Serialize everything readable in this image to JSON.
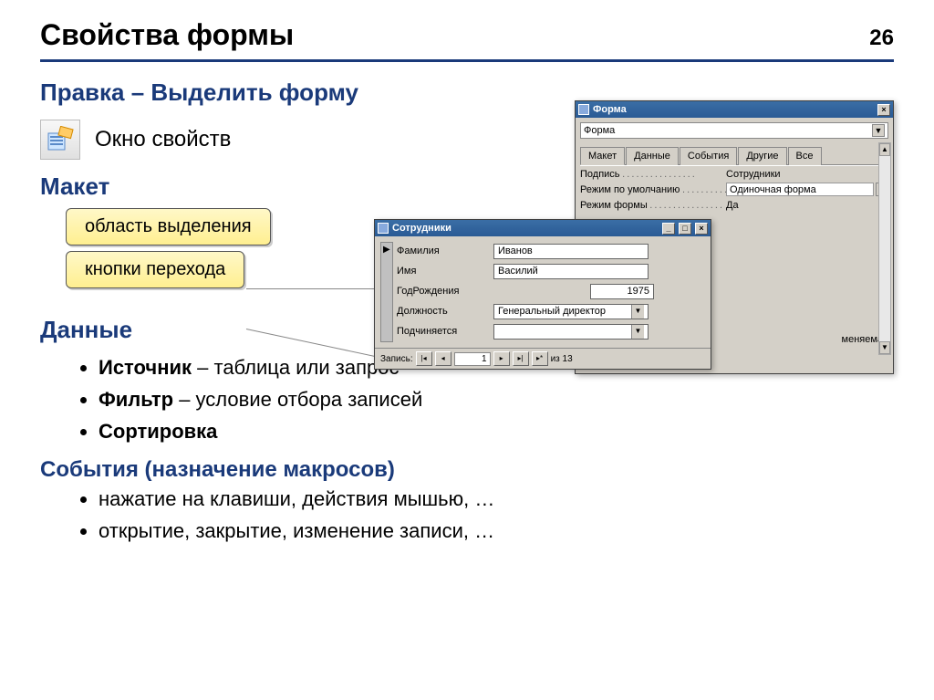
{
  "pageNumber": "26",
  "title": "Свойства формы",
  "breadcrumb": "Правка – Выделить форму",
  "propsIconLabel": "Окно свойств",
  "sections": {
    "maket": "Макет",
    "data": "Данные",
    "events": "События (назначение макросов)"
  },
  "callouts": {
    "selectionArea": "область выделения",
    "navButtons": "кнопки перехода"
  },
  "dataBullets": {
    "b1bold": "Источник",
    "b1rest": " – таблица или запрос",
    "b2bold": "Фильтр",
    "b2rest": " – условие отбора записей",
    "b3": "Сортировка"
  },
  "eventBullets": {
    "e1": "нажатие на клавиши, действия мышью, …",
    "e2": "открытие, закрытие, изменение записи, …"
  },
  "formWindow": {
    "title": "Форма",
    "combo": "Форма",
    "tabs": [
      "Макет",
      "Данные",
      "События",
      "Другие",
      "Все"
    ],
    "rows": [
      {
        "label": "Подпись",
        "value": "Сотрудники",
        "dd": false
      },
      {
        "label": "Режим по умолчанию",
        "value": "Одиночная форма",
        "dd": true
      },
      {
        "label": "Режим формы",
        "value": "Да",
        "dd": false
      }
    ],
    "extraRow": "меняемая"
  },
  "employeeWindow": {
    "title": "Сотрудники",
    "fields": [
      {
        "label": "Фамилия",
        "value": "Иванов",
        "type": "text"
      },
      {
        "label": "Имя",
        "value": "Василий",
        "type": "text"
      },
      {
        "label": "ГодРождения",
        "value": "1975",
        "type": "short"
      },
      {
        "label": "Должность",
        "value": "Генеральный директор",
        "type": "combo"
      },
      {
        "label": "Подчиняется",
        "value": "",
        "type": "combo"
      }
    ],
    "nav": {
      "label": "Запись:",
      "current": "1",
      "of": "из  13"
    }
  }
}
